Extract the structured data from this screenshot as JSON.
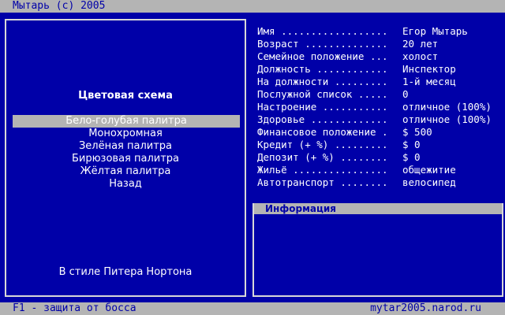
{
  "topbar": {
    "title": "Мытарь (c) 2005"
  },
  "left": {
    "section_title": "Цветовая схема",
    "menu": [
      {
        "label": "Бело-голубая палитра"
      },
      {
        "label": "Монохромная"
      },
      {
        "label": "Зелёная палитра"
      },
      {
        "label": "Бирюзовая палитра"
      },
      {
        "label": "Жёлтая палитра"
      },
      {
        "label": "Назад"
      }
    ],
    "note": "В стиле Питера Нортона"
  },
  "stats": [
    {
      "label": "Имя ..................",
      "value": "Егор Мытарь"
    },
    {
      "label": "Возраст ..............",
      "value": "20 лет"
    },
    {
      "label": "Семейное положение ...",
      "value": "холост"
    },
    {
      "label": "Должность ............",
      "value": "Инспектор"
    },
    {
      "label": "На должности .........",
      "value": "1-й месяц"
    },
    {
      "label": "Послужной список .....",
      "value": "0"
    },
    {
      "label": "Настроение ...........",
      "value": "отличное (100%)"
    },
    {
      "label": "Здоровье .............",
      "value": "отличное (100%)"
    },
    {
      "label": "Финансовое положение .",
      "value": "$ 500"
    },
    {
      "label": "Кредит (+ %) .........",
      "value": "$ 0"
    },
    {
      "label": "Депозит (+ %) ........",
      "value": "$ 0"
    },
    {
      "label": "Жильё ................",
      "value": "общежитие"
    },
    {
      "label": "Автотранспорт ........",
      "value": "велосипед"
    }
  ],
  "info": {
    "header": "Информация"
  },
  "bottombar": {
    "hint": "F1 - защита от босса",
    "site": "mytar2005.narod.ru"
  },
  "colors": {
    "background": "#0000a8",
    "bar": "#b4b4b4",
    "text": "#ffffff"
  }
}
